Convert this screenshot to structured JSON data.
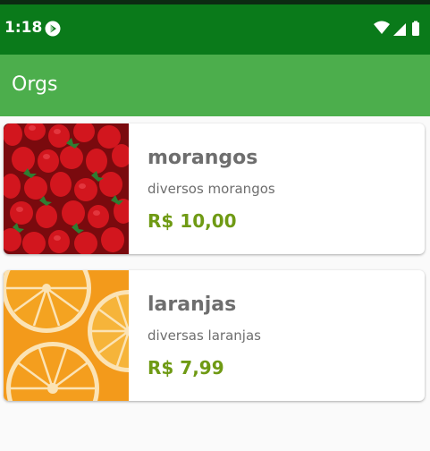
{
  "status_bar": {
    "time": "1:18",
    "app_icon": "play-store-icon",
    "icons": [
      "wifi-icon",
      "signal-icon",
      "battery-icon"
    ]
  },
  "app_bar": {
    "title": "Orgs"
  },
  "products": [
    {
      "name": "morangos",
      "description": "diversos morangos",
      "price": "R$ 10,00",
      "image": "strawberries"
    },
    {
      "name": "laranjas",
      "description": "diversas laranjas",
      "price": "R$ 7,99",
      "image": "oranges"
    }
  ],
  "colors": {
    "status_bar": "#0a7a1a",
    "app_bar": "#4cae4c",
    "price": "#6f9a14",
    "text": "#6e6e6e"
  }
}
